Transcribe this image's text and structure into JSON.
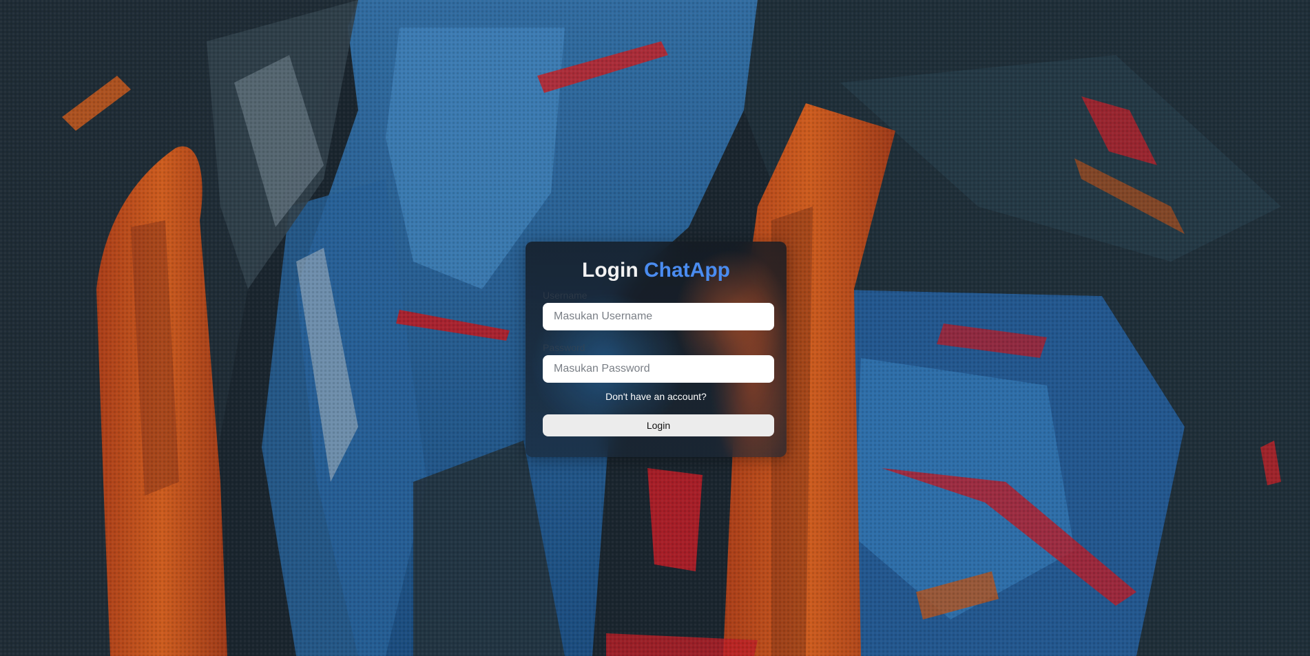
{
  "login": {
    "title_prefix": "Login",
    "title_brand": "ChatApp",
    "username_label": "Username",
    "username_placeholder": "Masukan Username",
    "password_label": "Password",
    "password_placeholder": "Masukan Password",
    "signup_link": "Don't have an account?",
    "submit_label": "Login"
  },
  "colors": {
    "brand_accent": "#4a8cf0",
    "card_text": "#f2f2f2",
    "button_bg": "#ececec"
  }
}
